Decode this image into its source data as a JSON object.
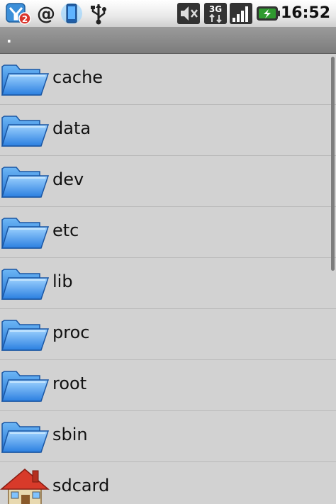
{
  "status_bar": {
    "notification_badge": "2",
    "network_type": "3G",
    "time": "16:52",
    "icons": [
      "app-notification-icon",
      "email-icon",
      "data-sync-icon",
      "usb-icon",
      "mute-icon",
      "network-3g-icon",
      "signal-icon",
      "battery-icon"
    ]
  },
  "path": ".",
  "files": [
    {
      "name": "cache",
      "icon": "folder-icon"
    },
    {
      "name": "data",
      "icon": "folder-icon"
    },
    {
      "name": "dev",
      "icon": "folder-icon"
    },
    {
      "name": "etc",
      "icon": "folder-icon"
    },
    {
      "name": "lib",
      "icon": "folder-icon"
    },
    {
      "name": "proc",
      "icon": "folder-icon"
    },
    {
      "name": "root",
      "icon": "folder-icon"
    },
    {
      "name": "sbin",
      "icon": "folder-icon"
    },
    {
      "name": "sdcard",
      "icon": "home-icon"
    }
  ],
  "colors": {
    "folder": "#3a8ee6",
    "list_background": "#d2d2d2",
    "path_bar": "#8a8a8a"
  }
}
